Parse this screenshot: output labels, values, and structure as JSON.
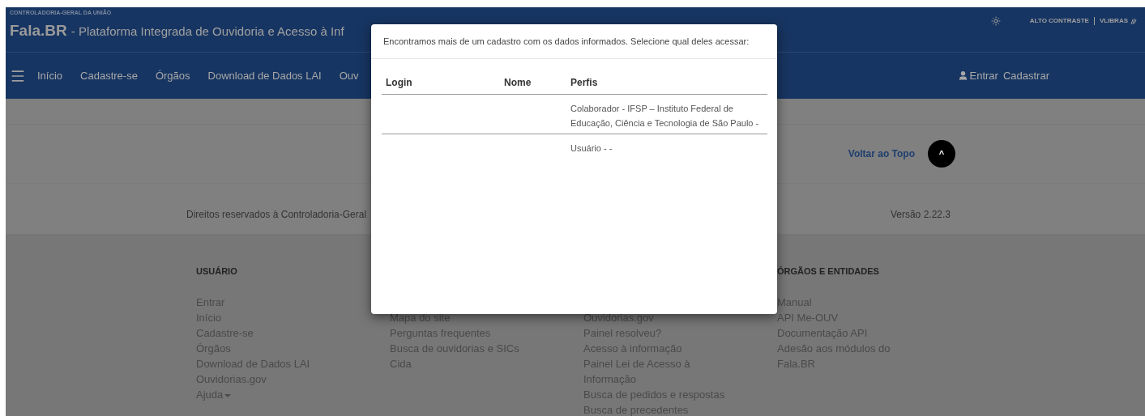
{
  "top_bar": {
    "org": "CONTROLADORIA-GERAL DA UNIÃO",
    "brand": "Fala.BR",
    "subtitle": "- Plataforma Integrada de Ouvidoria e Acesso à Inf",
    "links": [
      "ALTO CONTRASTE",
      "VLIBRAS"
    ]
  },
  "nav": {
    "items": [
      "Início",
      "Cadastre-se",
      "Órgãos",
      "Download de Dados LAI",
      "Ouv"
    ],
    "user_links": [
      "Entrar",
      "Cadastrar"
    ]
  },
  "back_to_top": {
    "label": "Voltar ao Topo",
    "button": "^"
  },
  "copyright": "Direitos reservados à Controladoria-Geral",
  "version": "Versão 2.22.3",
  "footer_columns": [
    {
      "heading": "USUÁRIO",
      "links": [
        "Entrar",
        "Início",
        "Cadastre-se",
        "Órgãos",
        "Download de Dados LAI",
        "Ouvidorias.gov",
        "Ajuda"
      ]
    },
    {
      "links": [
        "Mapa do site",
        "Perguntas frequentes",
        "Busca de ouvidorias e SICs",
        "Cida"
      ]
    },
    {
      "links": [
        "Ouvidorias.gov",
        "Painel resolveu?",
        "Acesso à informação",
        "Painel Lei de Acesso à Informação",
        "Busca de pedidos e respostas",
        "Busca de precedentes"
      ]
    },
    {
      "heading": "ÓRGÃOS E ENTIDADES",
      "links": [
        "Manual",
        "API Me-OUV",
        "Documentação API",
        "Adesão aos módulos do Fala.BR"
      ]
    }
  ],
  "dialog": {
    "message": "Encontramos mais de um cadastro com os dados informados. Selecione qual deles acessar:",
    "columns": [
      "Login",
      "Nome",
      "Perfis"
    ],
    "rows": [
      {
        "profile": "Colaborador - IFSP – Instituto Federal de Educação, Ciência e Tecnologia de São Paulo -"
      },
      {
        "profile": "Usuário - -"
      }
    ]
  }
}
